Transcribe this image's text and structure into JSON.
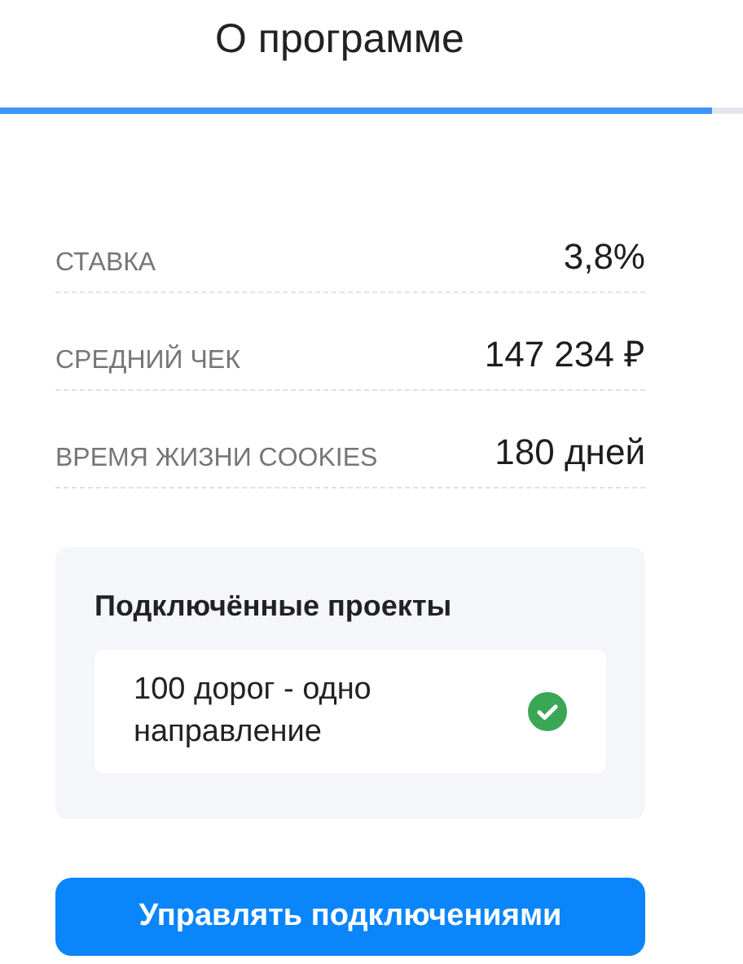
{
  "tabs": [
    {
      "label": "О программе",
      "selected": true
    }
  ],
  "stats": [
    {
      "label": "СТАВКА",
      "value": "3,8%"
    },
    {
      "label": "СРЕДНИЙ ЧЕК",
      "value": "147 234 ₽"
    },
    {
      "label": "ВРЕМЯ ЖИЗНИ COOKIES",
      "value": "180 дней"
    }
  ],
  "projects": {
    "title": "Подключённые проекты",
    "items": [
      {
        "name": "100 дорог - одно направление",
        "connected": true
      }
    ]
  },
  "button": "Управлять подключениями"
}
